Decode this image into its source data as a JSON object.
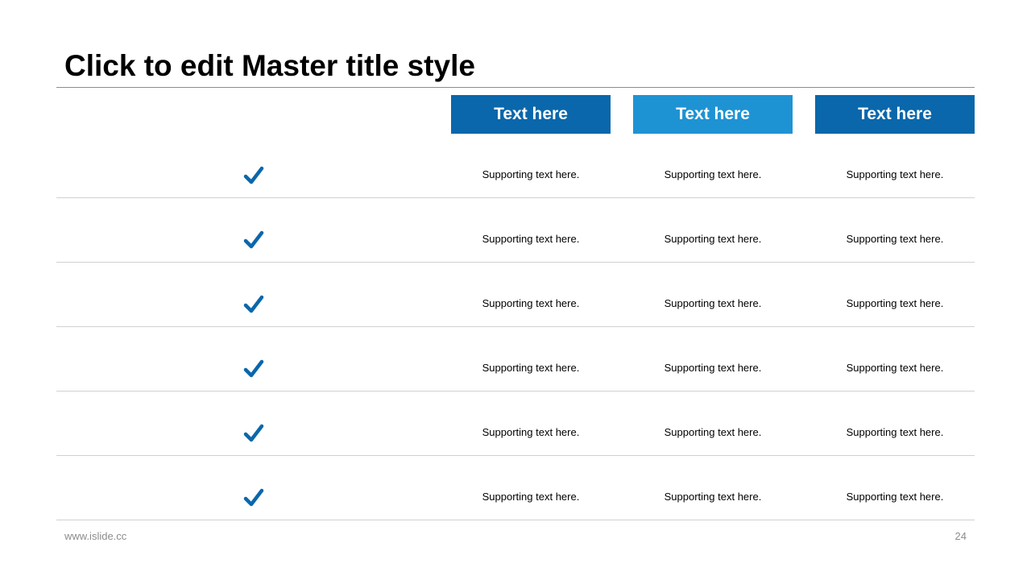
{
  "slide": {
    "title": "Click to edit Master title style",
    "footer_url": "www.islide.cc",
    "page_number": "24"
  },
  "colors": {
    "header_dark": "#0a67ab",
    "header_light": "#1e93d3",
    "check": "#0a67ab"
  },
  "columns": [
    {
      "label": "Text here",
      "style": "dark"
    },
    {
      "label": "Text here",
      "style": "light"
    },
    {
      "label": "Text here",
      "style": "dark"
    }
  ],
  "rows": [
    {
      "icon": "check-icon",
      "cells": [
        "Supporting  text here.",
        "Supporting  text here.",
        "Supporting  text here."
      ]
    },
    {
      "icon": "check-icon",
      "cells": [
        "Supporting  text here.",
        "Supporting  text here.",
        "Supporting  text here."
      ]
    },
    {
      "icon": "check-icon",
      "cells": [
        "Supporting  text here.",
        "Supporting  text here.",
        "Supporting  text here."
      ]
    },
    {
      "icon": "check-icon",
      "cells": [
        "Supporting  text here.",
        "Supporting  text here.",
        "Supporting  text here."
      ]
    },
    {
      "icon": "check-icon",
      "cells": [
        "Supporting  text here.",
        "Supporting  text here.",
        "Supporting  text here."
      ]
    },
    {
      "icon": "check-icon",
      "cells": [
        "Supporting  text here.",
        "Supporting  text here.",
        "Supporting  text here."
      ]
    }
  ]
}
